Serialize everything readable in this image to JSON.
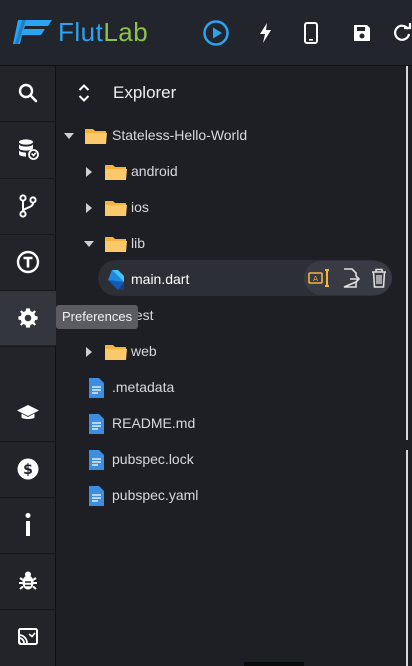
{
  "app": {
    "name_part1": "Flut",
    "name_part2": "Lab"
  },
  "toolbar": {
    "run_icon": "play-circle-icon",
    "hot_reload_icon": "lightning-icon",
    "device_icon": "phone-icon",
    "save_icon": "save-icon",
    "refresh_icon": "refresh-icon"
  },
  "sidebar": {
    "items": [
      {
        "id": "search",
        "icon": "search-icon"
      },
      {
        "id": "database",
        "icon": "database-sync-icon"
      },
      {
        "id": "source-control",
        "icon": "branch-icon"
      },
      {
        "id": "typography",
        "icon": "t-circle-icon"
      },
      {
        "id": "preferences",
        "icon": "gear-icon",
        "active": true
      },
      {
        "id": "learn",
        "icon": "graduation-cap-icon"
      },
      {
        "id": "billing",
        "icon": "dollar-circle-icon"
      },
      {
        "id": "info",
        "icon": "info-icon"
      },
      {
        "id": "debug",
        "icon": "bug-icon"
      },
      {
        "id": "cast",
        "icon": "cast-icon"
      }
    ],
    "tooltip": "Preferences"
  },
  "explorer": {
    "title": "Explorer",
    "tree": [
      {
        "label": "Stateless-Hello-World",
        "type": "folder",
        "expanded": true,
        "depth": 0
      },
      {
        "label": "android",
        "type": "folder",
        "expanded": false,
        "depth": 1
      },
      {
        "label": "ios",
        "type": "folder",
        "expanded": false,
        "depth": 1
      },
      {
        "label": "lib",
        "type": "folder",
        "expanded": true,
        "depth": 1
      },
      {
        "label": "main.dart",
        "type": "dart",
        "depth": 2,
        "selected": true
      },
      {
        "label": "test",
        "type": "folder",
        "expanded": false,
        "depth": 1
      },
      {
        "label": "web",
        "type": "folder",
        "expanded": false,
        "depth": 1
      },
      {
        "label": ".metadata",
        "type": "file",
        "depth": 0
      },
      {
        "label": "README.md",
        "type": "file",
        "depth": 0
      },
      {
        "label": "pubspec.lock",
        "type": "file",
        "depth": 0
      },
      {
        "label": "pubspec.yaml",
        "type": "file",
        "depth": 0
      }
    ],
    "row_actions": [
      "rename-icon",
      "move-file-icon",
      "delete-icon"
    ]
  },
  "colors": {
    "accent": "#2aa3f0",
    "brand_green": "#8bc34a",
    "folder": "#f7b23b",
    "file": "#3d8ee0"
  }
}
